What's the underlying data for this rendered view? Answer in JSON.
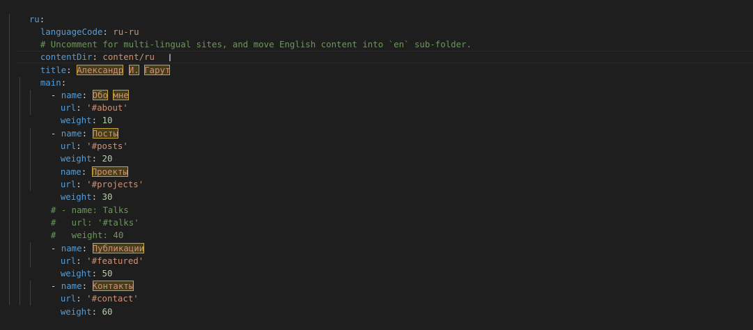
{
  "editor": {
    "language": "yaml",
    "lines": [
      {
        "key": "ru",
        "sep": ":"
      },
      {
        "key": "languageCode",
        "sep": ": ",
        "value": "ru-ru"
      },
      {
        "comment": "# Uncomment for multi-lingual sites, and move English content into `en` sub-folder."
      },
      {
        "key": "contentDir",
        "sep": ": ",
        "value": "content/ru"
      },
      {
        "key": "title",
        "sep": ": ",
        "value_parts": [
          "Александр",
          "И.",
          "Гарут"
        ]
      },
      {
        "key": "main",
        "sep": ":"
      },
      {
        "dash": "- ",
        "key": "name",
        "sep": ": ",
        "value_parts": [
          "Обо",
          "мне"
        ]
      },
      {
        "key": "url",
        "sep": ": ",
        "value": "'#about'"
      },
      {
        "key": "weight",
        "sep": ": ",
        "value": "10"
      },
      {
        "dash": "- ",
        "key": "name",
        "sep": ": ",
        "value_parts": [
          "Посты"
        ]
      },
      {
        "key": "url",
        "sep": ": ",
        "value": "'#posts'"
      },
      {
        "key": "weight",
        "sep": ": ",
        "value": "20"
      },
      {
        "key": "name",
        "sep": ": ",
        "value_parts": [
          "Проекты"
        ]
      },
      {
        "key": "url",
        "sep": ": ",
        "value": "'#projects'"
      },
      {
        "key": "weight",
        "sep": ": ",
        "value": "30"
      },
      {
        "comment": "# - name: Talks"
      },
      {
        "comment": "#   url: '#talks'"
      },
      {
        "comment": "#   weight: 40"
      },
      {
        "dash": "- ",
        "key": "name",
        "sep": ": ",
        "value_parts": [
          "Публикации"
        ]
      },
      {
        "key": "url",
        "sep": ": ",
        "value": "'#featured'"
      },
      {
        "key": "weight",
        "sep": ": ",
        "value": "50"
      },
      {
        "dash": "- ",
        "key": "name",
        "sep": ": ",
        "value_parts": [
          "Контакты"
        ]
      },
      {
        "key": "url",
        "sep": ": ",
        "value": "'#contact'"
      },
      {
        "key": "weight",
        "sep": ": ",
        "value": "60"
      }
    ],
    "cursor_glyph": "I"
  },
  "colors": {
    "background": "#1e1e1e",
    "key": "#569cd6",
    "string": "#ce9178",
    "number": "#b5cea8",
    "comment": "#6a9955",
    "highlight_border": "#c8a53a"
  }
}
